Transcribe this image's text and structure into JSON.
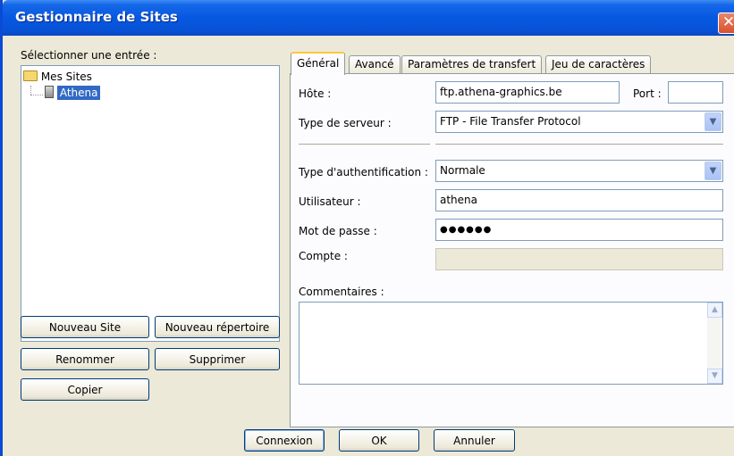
{
  "window": {
    "title": "Gestionnaire de Sites",
    "close_glyph": "✕"
  },
  "left": {
    "select_label": "Sélectionner une entrée :",
    "tree": {
      "root": "Mes Sites",
      "child": "Athena"
    },
    "buttons": {
      "new_site": "Nouveau Site",
      "new_folder": "Nouveau répertoire",
      "rename": "Renommer",
      "delete": "Supprimer",
      "copy": "Copier"
    }
  },
  "tabs": [
    "Général",
    "Avancé",
    "Paramètres de transfert",
    "Jeu de caractères"
  ],
  "general": {
    "host_label": "Hôte :",
    "host_value": "ftp.athena-graphics.be",
    "port_label": "Port :",
    "port_value": "",
    "server_type_label": "Type de serveur :",
    "server_type_value": "FTP - File Transfer Protocol",
    "auth_label": "Type d'authentification :",
    "auth_value": "Normale",
    "user_label": "Utilisateur :",
    "user_value": "athena",
    "password_label": "Mot de passe :",
    "password_value": "●●●●●●",
    "account_label": "Compte :",
    "account_value": "",
    "comments_label": "Commentaires :"
  },
  "footer": {
    "connect": "Connexion",
    "ok": "OK",
    "cancel": "Annuler"
  },
  "colors": {
    "titlebar": "#0758e0",
    "selection": "#316ac5",
    "window_bg": "#ece9d8"
  },
  "icons": [
    "folder-icon",
    "server-icon",
    "close-icon",
    "dropdown-arrow-icon",
    "scroll-up-icon",
    "scroll-down-icon"
  ]
}
